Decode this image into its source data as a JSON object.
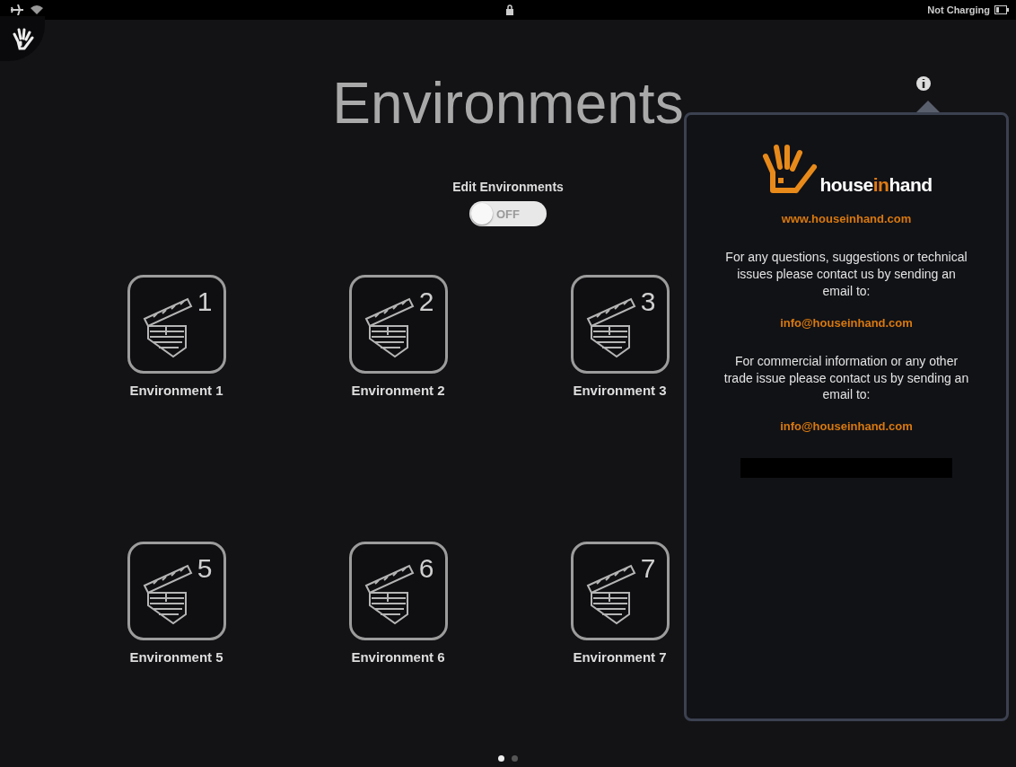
{
  "status_bar": {
    "battery_text": "Not Charging"
  },
  "title": "Environments",
  "edit_toggle": {
    "label": "Edit Environments",
    "on": false,
    "state_text": "OFF"
  },
  "environments": [
    {
      "number": "1",
      "name": "Environment 1"
    },
    {
      "number": "2",
      "name": "Environment 2"
    },
    {
      "number": "3",
      "name": "Environment 3"
    },
    {
      "number": "5",
      "name": "Environment 5"
    },
    {
      "number": "6",
      "name": "Environment 6"
    },
    {
      "number": "7",
      "name": "Environment 7"
    }
  ],
  "pages": [
    {
      "selected": true
    },
    {
      "selected": false
    }
  ],
  "info_popover": {
    "logo_parts": [
      {
        "text": "house",
        "accent": false
      },
      {
        "text": "in",
        "accent": true
      },
      {
        "text": "hand",
        "accent": false
      }
    ],
    "website": "www.houseinhand.com",
    "support_text": "For any questions, suggestions or technical issues please contact us by sending an email to:",
    "support_email": "info@houseinhand.com",
    "commercial_text": "For commercial information or any other trade issue please contact us by sending an email to:",
    "commercial_email": "info@houseinhand.com"
  }
}
